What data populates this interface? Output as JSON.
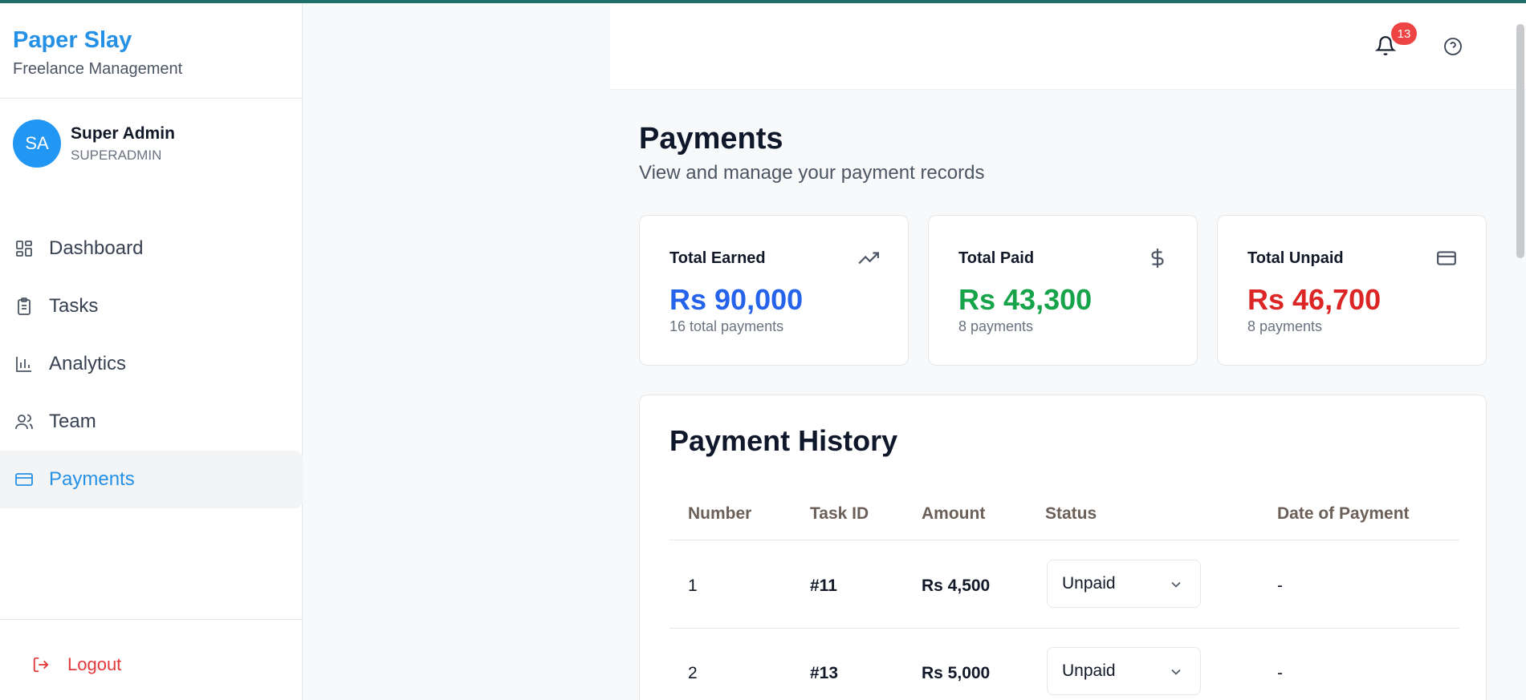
{
  "brand": {
    "title": "Paper Slay",
    "subtitle": "Freelance Management"
  },
  "user": {
    "initials": "SA",
    "name": "Super Admin",
    "role": "SUPERADMIN"
  },
  "nav": [
    {
      "label": "Dashboard",
      "icon": "dashboard-icon",
      "active": false
    },
    {
      "label": "Tasks",
      "icon": "clipboard-icon",
      "active": false
    },
    {
      "label": "Analytics",
      "icon": "bar-chart-icon",
      "active": false
    },
    {
      "label": "Team",
      "icon": "users-icon",
      "active": false
    },
    {
      "label": "Payments",
      "icon": "credit-card-icon",
      "active": true
    }
  ],
  "logout_label": "Logout",
  "header": {
    "notification_count": "13"
  },
  "page": {
    "title": "Payments",
    "subtitle": "View and manage your payment records"
  },
  "stats": [
    {
      "label": "Total Earned",
      "value": "Rs 90,000",
      "note": "16 total payments",
      "color": "#2563eb",
      "icon": "trending-up-icon"
    },
    {
      "label": "Total Paid",
      "value": "Rs 43,300",
      "note": "8 payments",
      "color": "#16a34a",
      "icon": "dollar-icon"
    },
    {
      "label": "Total Unpaid",
      "value": "Rs 46,700",
      "note": "8 payments",
      "color": "#dc2626",
      "icon": "credit-card-icon"
    }
  ],
  "history": {
    "title": "Payment History",
    "columns": [
      "Number",
      "Task ID",
      "Amount",
      "Status",
      "Date of Payment"
    ],
    "rows": [
      {
        "number": "1",
        "task_id": "#11",
        "amount": "Rs 4,500",
        "status": "Unpaid",
        "date": "-"
      },
      {
        "number": "2",
        "task_id": "#13",
        "amount": "Rs 5,000",
        "status": "Unpaid",
        "date": "-"
      }
    ]
  },
  "colors": {
    "brand": "#2490e6",
    "accent": "#2196f3",
    "danger": "#ef4444",
    "active_bg": "#f3f4f6"
  }
}
